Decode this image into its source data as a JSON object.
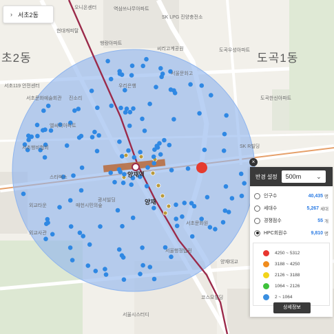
{
  "breadcrumb": {
    "label": "서초2동"
  },
  "map": {
    "area_labels": [
      "초2동",
      "도곡1동"
    ],
    "station_label": "양재역",
    "station_label_2": "양재",
    "poi_labels": [
      "오니온센터",
      "역삼쓰나무아파트",
      "SK LPG 진양충전소",
      "현대캐피탈",
      "행랑아파트",
      "씨리고계공원",
      "도곡우성아파트",
      "서초119 안전센터",
      "서초문화예술회관",
      "진소리",
      "우리은행",
      "서울문화고",
      "서초행비협회",
      "스타벅스",
      "엘씨티아파트",
      "광서빌딩",
      "외교타운",
      "외교사관",
      "매헌시민의숲",
      "서울행정법원",
      "도곡한신아파트",
      "SK R빌딩",
      "양재대교",
      "서울시스터디",
      "코스모빌딩",
      "서초문화원"
    ]
  },
  "panel": {
    "radius_label": "반경 설정",
    "radius_value": "500m",
    "options": [
      {
        "name": "인구수",
        "value": "40,435",
        "unit": "명",
        "checked": false
      },
      {
        "name": "세대수",
        "value": "5,267",
        "unit": "세대",
        "checked": false
      },
      {
        "name": "경쟁점수",
        "value": "55",
        "unit": "개",
        "checked": false
      },
      {
        "name": "HPC회원수",
        "value": "9,810",
        "unit": "명",
        "checked": true
      }
    ],
    "legend": [
      {
        "range": "4250 ~ 5312",
        "color": "#e8362f"
      },
      {
        "range": "3188 ~ 4250",
        "color": "#f08c1e"
      },
      {
        "range": "2126 ~ 3188",
        "color": "#f2d41a"
      },
      {
        "range": "1064 ~ 2126",
        "color": "#3fc23b"
      },
      {
        "range": "2 ~ 1064",
        "color": "#3a8fe0"
      }
    ],
    "detail_button": "상세정보"
  },
  "colors": {
    "circle_fill": "#8fb5ee",
    "dot_blue": "#2f88e3",
    "marker_red": "#e53b2f",
    "subway_line": "#9b2a4a",
    "road_orange": "#e6a06a"
  }
}
